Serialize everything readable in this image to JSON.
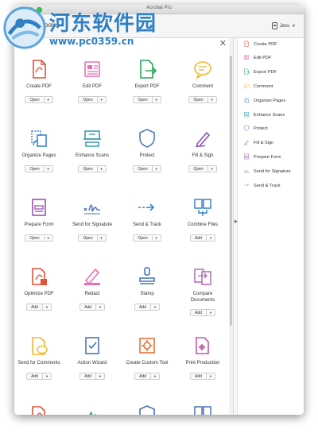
{
  "window": {
    "title": "Acrobat Pro",
    "toolbar_left": "Tools"
  },
  "user": {
    "name": "Jess"
  },
  "watermark": {
    "title": "河东软件园",
    "url": "www.pc0359.cn"
  },
  "tools": [
    {
      "label": "Create PDF",
      "action": "Open",
      "color": "#e2533c"
    },
    {
      "label": "Edit PDF",
      "action": "Open",
      "color": "#e86fb3"
    },
    {
      "label": "Export PDF",
      "action": "Open",
      "color": "#26a65b"
    },
    {
      "label": "Comment",
      "action": "Open",
      "color": "#f2b633"
    },
    {
      "label": "Organize Pages",
      "action": "Open",
      "color": "#3c84cb"
    },
    {
      "label": "Enhance Scans",
      "action": "Open",
      "color": "#3a9fb5"
    },
    {
      "label": "Protect",
      "action": "Open",
      "color": "#4a7dc5"
    },
    {
      "label": "Fill & Sign",
      "action": "Open",
      "color": "#8b58b3"
    },
    {
      "label": "Prepare Form",
      "action": "Open",
      "color": "#9b55ae"
    },
    {
      "label": "Send for Signature",
      "action": "Open",
      "color": "#4a72b8"
    },
    {
      "label": "Send & Track",
      "action": "Open",
      "color": "#3c84cb"
    },
    {
      "label": "Combine Files",
      "action": "Add",
      "color": "#3c84cb"
    },
    {
      "label": "Optimize PDF",
      "action": "Add",
      "color": "#e2533c"
    },
    {
      "label": "Redact",
      "action": "Add",
      "color": "#e86fb3"
    },
    {
      "label": "Stamp",
      "action": "Add",
      "color": "#4a72b8"
    },
    {
      "label": "Compare Documents",
      "action": "Add",
      "color": "#b269b5"
    },
    {
      "label": "Send for Comments",
      "action": "Add",
      "color": "#f2b633"
    },
    {
      "label": "Action Wizard",
      "action": "Add",
      "color": "#4a72b8"
    },
    {
      "label": "Create Custom Tool",
      "action": "Add",
      "color": "#e2733c"
    },
    {
      "label": "Print Production",
      "action": "Add",
      "color": "#c05aa6"
    }
  ],
  "partial_row": [
    {
      "color": "#e2533c"
    },
    {
      "color": "#26a65b"
    },
    {
      "color": "#4a72b8"
    },
    {
      "color": "#4a72b8"
    }
  ],
  "side_panel": {
    "items": [
      {
        "label": "Create PDF",
        "color": "#e2533c"
      },
      {
        "label": "Edit PDF",
        "color": "#e86fb3"
      },
      {
        "label": "Export PDF",
        "color": "#26a65b"
      },
      {
        "label": "Comment",
        "color": "#f2b633"
      },
      {
        "label": "Organize Pages",
        "color": "#3c84cb"
      },
      {
        "label": "Enhance Scans",
        "color": "#3a9fb5"
      },
      {
        "label": "Protect",
        "color": "#4a7dc5"
      },
      {
        "label": "Fill & Sign",
        "color": "#8b58b3"
      },
      {
        "label": "Prepare Form",
        "color": "#9b55ae"
      },
      {
        "label": "Send for Signature",
        "color": "#4a72b8"
      },
      {
        "label": "Send & Track",
        "color": "#3c84cb"
      }
    ]
  }
}
